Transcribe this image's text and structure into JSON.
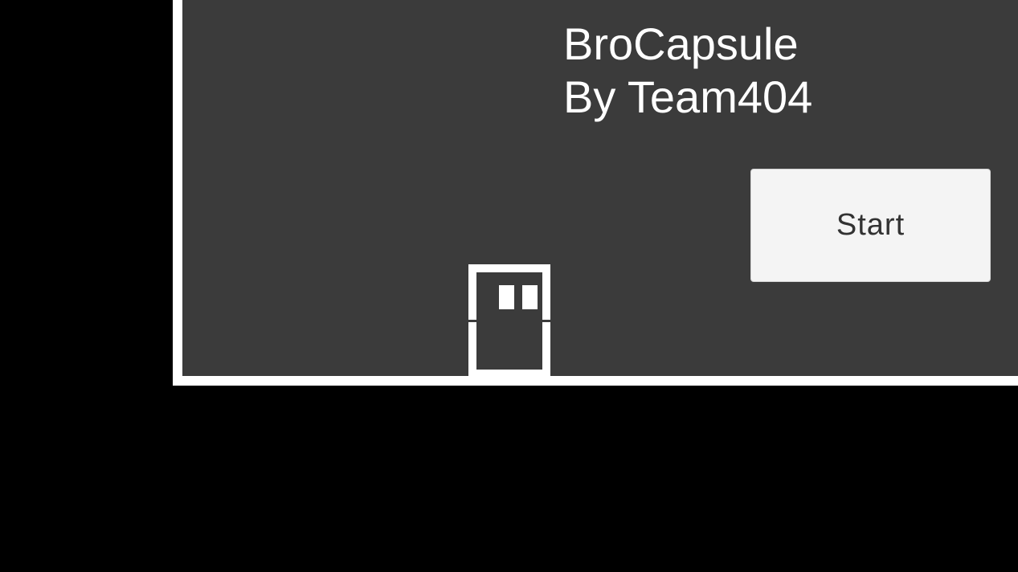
{
  "game": {
    "title_line1": "BroCapsule",
    "title_line2": "By Team404",
    "start_button_label": "Start"
  },
  "colors": {
    "background": "#000000",
    "arena_fill": "#3b3b3b",
    "arena_border": "#ffffff",
    "title_text": "#ffffff",
    "button_fill": "#f4f4f4",
    "button_text": "#323232",
    "player": "#ffffff"
  },
  "icons": {
    "player_character": "capsule-character-icon"
  }
}
